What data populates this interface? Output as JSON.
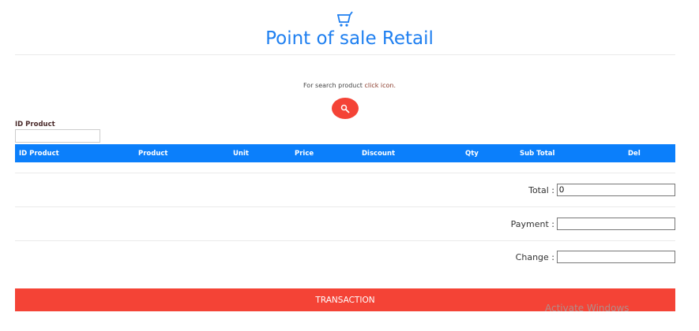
{
  "header": {
    "title": "Point of sale Retail",
    "icon": "cart-icon"
  },
  "search": {
    "hint_prefix": "For search product ",
    "hint_link": "click icon.",
    "icon": "search-icon"
  },
  "id_field": {
    "label": "ID Product",
    "value": ""
  },
  "table": {
    "columns": [
      "ID Product",
      "Product",
      "Unit",
      "Price",
      "Discount",
      "Qty",
      "Sub Total",
      "Del"
    ]
  },
  "totals": {
    "total_label": "Total :",
    "total_value": "0",
    "payment_label": "Payment :",
    "payment_value": "",
    "change_label": "Change :",
    "change_value": ""
  },
  "transaction_label": "TRANSACTION",
  "watermark": "Activate Windows",
  "colors": {
    "primary": "#0b7ffb",
    "accent": "#f44336"
  }
}
